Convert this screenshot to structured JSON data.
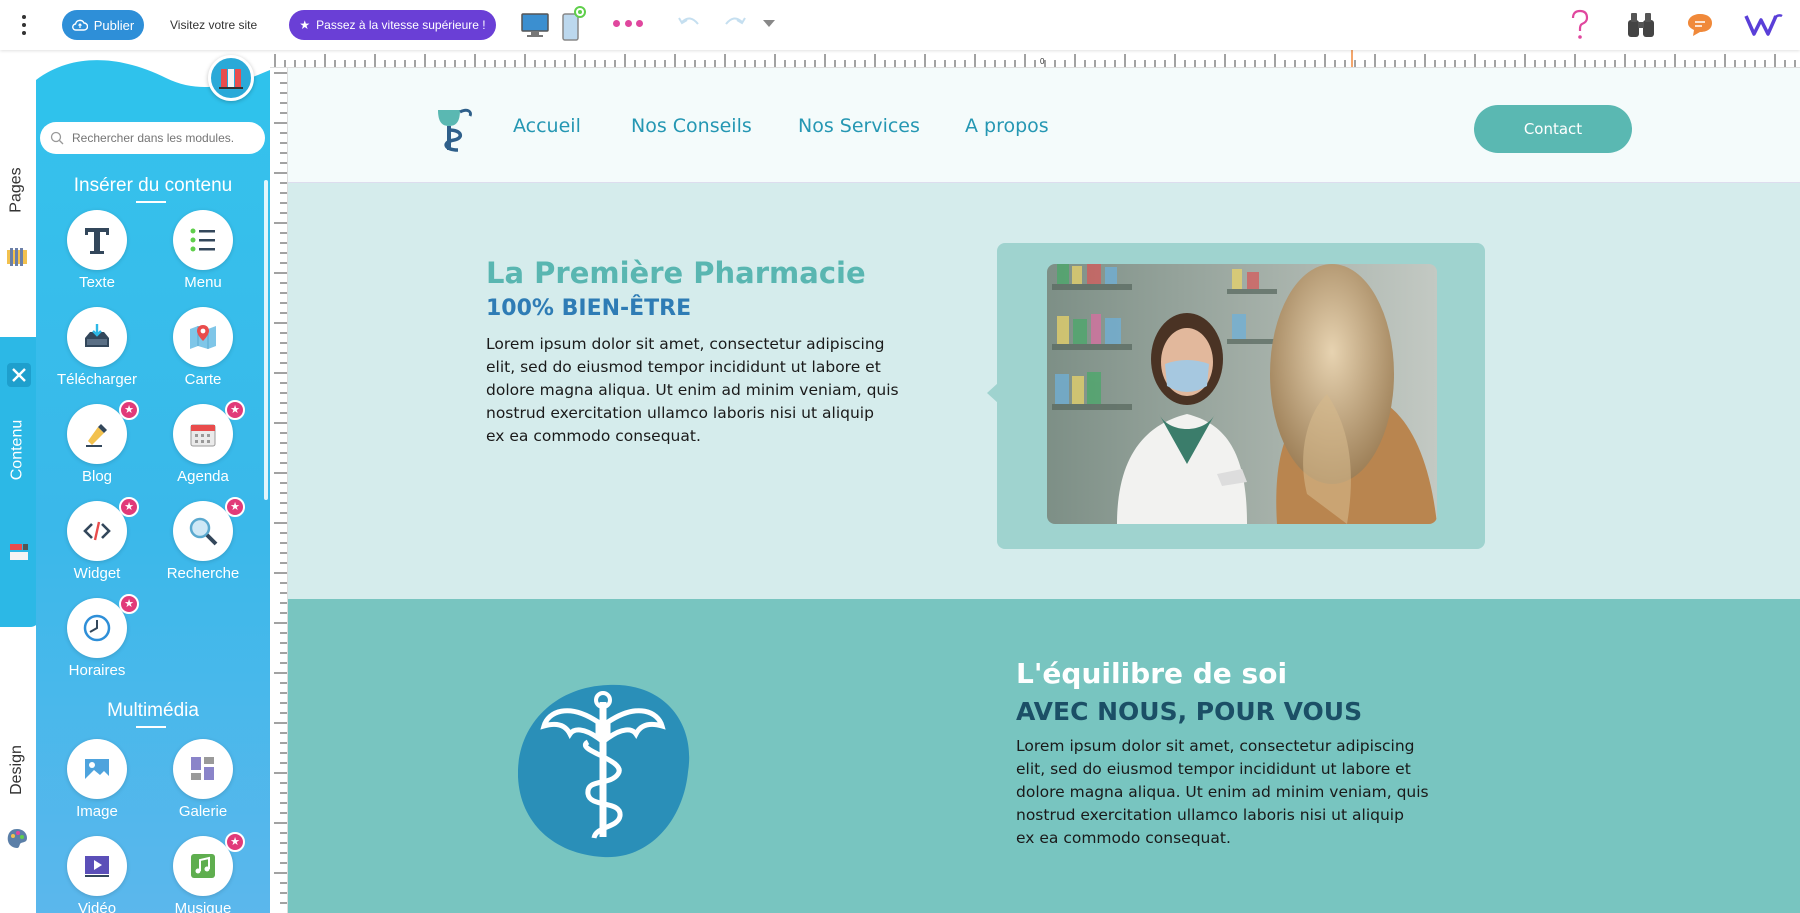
{
  "toolbar": {
    "publish_label": "Publier",
    "visit_label": "Visitez votre site",
    "upgrade_label": "Passez à la vitesse supérieure !",
    "icons": [
      "menu-icon",
      "cloud-upload-icon",
      "star-icon",
      "desktop-icon",
      "mobile-icon",
      "more-icon",
      "undo-icon",
      "redo-icon",
      "caret-down-icon",
      "help-icon",
      "binoculars-icon",
      "chat-icon",
      "logo-icon"
    ],
    "colors": {
      "publish": "#2e8fd8",
      "upgrade": "#6a3fd6",
      "more": "#e0479e"
    }
  },
  "left_tabs": {
    "pages": "Pages",
    "contenu": "Contenu",
    "design": "Design"
  },
  "panel": {
    "search_placeholder": "Rechercher dans les modules.",
    "section_insert": "Insérer du contenu",
    "section_media": "Multimédia",
    "modules": [
      {
        "label": "Texte",
        "icon": "text-icon",
        "premium": false
      },
      {
        "label": "Menu",
        "icon": "menu-list-icon",
        "premium": false
      },
      {
        "label": "Télécharger",
        "icon": "download-icon",
        "premium": false
      },
      {
        "label": "Carte",
        "icon": "map-icon",
        "premium": false
      },
      {
        "label": "Blog",
        "icon": "pen-icon",
        "premium": true
      },
      {
        "label": "Agenda",
        "icon": "calendar-icon",
        "premium": true
      },
      {
        "label": "Widget",
        "icon": "code-icon",
        "premium": true
      },
      {
        "label": "Recherche",
        "icon": "magnifier-icon",
        "premium": true
      },
      {
        "label": "Horaires",
        "icon": "clock-icon",
        "premium": true
      }
    ],
    "media_modules": [
      {
        "label": "Image",
        "icon": "image-icon",
        "premium": false
      },
      {
        "label": "Galerie",
        "icon": "gallery-icon",
        "premium": false
      },
      {
        "label": "Vidéo",
        "icon": "video-icon",
        "premium": false
      },
      {
        "label": "Musique",
        "icon": "music-icon",
        "premium": true
      }
    ],
    "colors": {
      "panel": "#34c3ec",
      "star": "#e13a79"
    }
  },
  "ruler": {
    "zero_label": "0"
  },
  "site": {
    "nav": [
      "Accueil",
      "Nos Conseils",
      "Nos Services",
      "A propos"
    ],
    "contact": "Contact",
    "section1": {
      "title": "La Première Pharmacie",
      "subtitle": "100% BIEN-ÊTRE",
      "body_lines": [
        "Lorem ipsum dolor sit amet, consectetur adipiscing",
        "elit, sed do eiusmod tempor incididunt ut labore et",
        "dolore magna aliqua. Ut enim ad minim veniam, quis",
        "nostrud exercitation ullamco laboris nisi ut aliquip",
        "ex ea commodo consequat."
      ]
    },
    "section2": {
      "title": "L'équilibre de soi",
      "subtitle": "AVEC NOUS, POUR VOUS",
      "body_lines": [
        "Lorem ipsum dolor sit amet, consectetur adipiscing",
        "elit, sed do eiusmod tempor incididunt ut labore et",
        "dolore magna aliqua. Ut enim ad minim veniam, quis",
        "nostrud exercitation ullamco laboris nisi ut aliquip",
        "ex ea commodo consequat."
      ]
    },
    "colors": {
      "header_bg": "#f4fbfb",
      "section1_bg": "#d5ecec",
      "section2_bg": "#78c5c0",
      "accent": "#5ab8b2",
      "nav": "#2597b3",
      "title1": "#59b6b1",
      "subtitle1": "#2e7cb5"
    }
  }
}
